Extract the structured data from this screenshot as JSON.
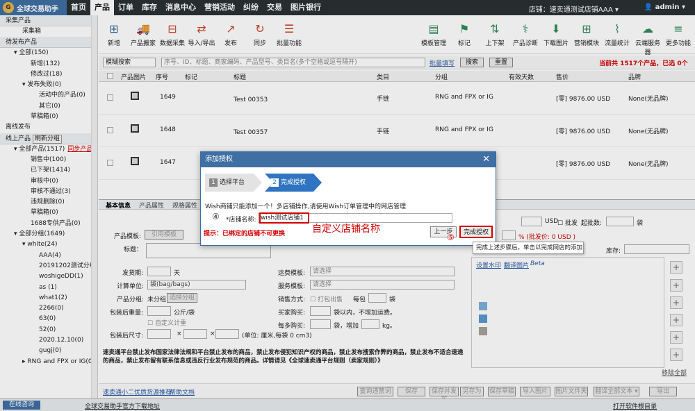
{
  "nav": {
    "logo": "全球交易助手",
    "items": [
      "首页",
      "产品",
      "订单",
      "库存",
      "消息中心",
      "营销活动",
      "纠纷",
      "交易",
      "图片银行"
    ],
    "shop": "店铺：速卖通测试店铺AAA ▾",
    "user": "admin ▾"
  },
  "sidebar": {
    "sections": [
      {
        "header": "采集产品",
        "items": [
          {
            "label": "采集箱",
            "indent": 2
          }
        ]
      },
      {
        "header": "待发布产品",
        "items": [
          {
            "label": "▾ 全部(150)",
            "indent": 1
          },
          {
            "label": "新增(132)",
            "indent": 3
          },
          {
            "label": "修改过(18)",
            "indent": 3
          },
          {
            "label": "▾ 发布失败(0)",
            "indent": 2
          },
          {
            "label": "活动中的产品(0)",
            "indent": 4
          },
          {
            "label": "其它(0)",
            "indent": 4
          },
          {
            "label": "草稿箱(0)",
            "indent": 3
          },
          {
            "label": "离线发布",
            "indent": 0
          }
        ]
      },
      {
        "header": "线上产品",
        "items": [
          {
            "label": "▾ 全部产品(1517)",
            "indent": 1
          },
          {
            "label": "销售中(100)",
            "indent": 3
          },
          {
            "label": "已下架(1414)",
            "indent": 3
          },
          {
            "label": "审核中(0)",
            "indent": 3
          },
          {
            "label": "审核不通过(3)",
            "indent": 3
          },
          {
            "label": "违规删除(0)",
            "indent": 3
          },
          {
            "label": "草稿箱(0)",
            "indent": 3
          },
          {
            "label": "1688专供产品(0)",
            "indent": 3
          },
          {
            "label": "▾ 全部分组(1649)",
            "indent": 1
          },
          {
            "label": "▾ white(24)",
            "indent": 2
          },
          {
            "label": "AAA(4)",
            "indent": 4
          },
          {
            "label": "20191202测试分组00",
            "indent": 4
          },
          {
            "label": "woshigeDD(1)",
            "indent": 4
          },
          {
            "label": "as (1)",
            "indent": 4
          },
          {
            "label": "what1(2)",
            "indent": 4
          },
          {
            "label": "2266(0)",
            "indent": 4
          },
          {
            "label": "63(0)",
            "indent": 4
          },
          {
            "label": "52(0)",
            "indent": 4
          },
          {
            "label": "2020.12.10(0)",
            "indent": 4
          },
          {
            "label": "gugj(0)",
            "indent": 4
          },
          {
            "label": "▸ RNG and FPX or IG(0)",
            "indent": 2
          }
        ]
      }
    ],
    "refresh": "刷新分组",
    "sync": "同步产品"
  },
  "toolbar": {
    "left": [
      "新增",
      "产品搬家",
      "数据采集",
      "导入/导出",
      "发布",
      "同步",
      "批量功能"
    ],
    "right": [
      "模板管理",
      "标记",
      "上下架",
      "产品诊断",
      "下载图片",
      "营销模块",
      "流量统计",
      "云端服务器",
      "更多功能"
    ]
  },
  "search": {
    "mode": "模糊搜索",
    "placeholder": "序号、ID、标题、商家编码、产品型号、类目名(多个空格或逗号隔开)",
    "batch": "批量填写",
    "search": "搜索",
    "reset": "重置",
    "summary": "当前共 1517个产品，已选 0个"
  },
  "grid": {
    "headers": [
      "产品图片",
      "序号",
      "标记",
      "标题",
      "类目",
      "分组",
      "有效天数",
      "售价",
      "品牌"
    ],
    "rows": [
      {
        "no": "1649",
        "title": "Test 00353",
        "cat": "手链",
        "group": "RNG and FPX or IG",
        "price": "[零] 9876.00 USD",
        "brand": "None(无品牌)"
      },
      {
        "no": "1648",
        "title": "Test 00357",
        "cat": "手链",
        "group": "RNG and FPX or IG",
        "price": "[零] 9876.00 USD",
        "brand": "None(无品牌)"
      },
      {
        "no": "1647",
        "title": "",
        "cat": "",
        "group": "",
        "price": "[零] 9876.00 USD",
        "brand": "None(无品牌)"
      }
    ]
  },
  "form": {
    "tabs": [
      "基本信息",
      "产品属性",
      "规格属性"
    ],
    "tpl_label": "产品模板:",
    "tpl_btn": "引用模板",
    "title_label": "标题：",
    "ship_label": "发货期:",
    "ship_unit": "天",
    "unit_label": "计算单位:",
    "unit_val": "袋(bag/bags)",
    "grp_label": "产品分组:",
    "grp_val": "未分组",
    "grp_btn": "选择分组",
    "weight_label": "包装后重量:",
    "weight_unit": "公斤/袋",
    "custom_weight": "自定义计重",
    "size_label": "包装后尺寸:",
    "size_unit": "(单位: 厘米,每袋  0 cm3)",
    "freight_label": "运费模板:",
    "svc_label": "服务模板:",
    "select_ph": "请选择",
    "sale_label": "销售方式:",
    "sale_pack": "打包出售",
    "per": "每包",
    "bag": "袋",
    "buy_label": "买家购买:",
    "buy_text": "袋以内，不增加运费。",
    "more_label": "每多购买:",
    "more_text": "袋，增加",
    "kg": "kg。",
    "usd": "USD",
    "batch": "批发",
    "minqty": "起批数:",
    "bag2": "袋",
    "pct": "% (批发价: 0 USD )",
    "stock": "库存:",
    "watermark": "设置水印",
    "translate": "翻译图片",
    "beta": "Beta",
    "remove_all": "移除全部",
    "notice": "速卖通平台禁止发布国家法律法规和平台禁止发布的商品，禁止发布侵犯知识产权的商品，禁止发布搜索作弊的商品，禁止发布不适合速递的商品，禁止发布留有联系信息或违反行业发布规范的商品。详情请见《全球速卖通平台规则（卖家规则）》"
  },
  "bottom": {
    "links": [
      "速卖通小二优质货源推荐",
      "帮助文档"
    ],
    "buttons": [
      "查询违禁词",
      "保存",
      "保存并发布",
      "另存为",
      "保存草稿",
      "导入图片",
      "图片文件夹",
      "翻译全部文本 ▾",
      "导出"
    ]
  },
  "status": {
    "online": "在线咨询",
    "download": "全球交易助手官方下载地址",
    "logs": "打开软件根目录"
  },
  "dialog": {
    "title": "添加授权",
    "close": "✕",
    "step1": "选择平台",
    "step2": "完成授权",
    "notice": "Wish商铺只能添加一个！多店铺操作,请使用Wish订单管理中的网店管理",
    "label": "*店铺名称:",
    "value": "wish测试店铺1",
    "circle4": "④",
    "annot": "自定义店铺名称",
    "tip": "提示：已绑定的店铺不可更换",
    "prev": "上一步",
    "finish": "完成授权",
    "circle5": "⑤",
    "tooltip": "完成上述步骤后，单击以完成网店的添加"
  }
}
